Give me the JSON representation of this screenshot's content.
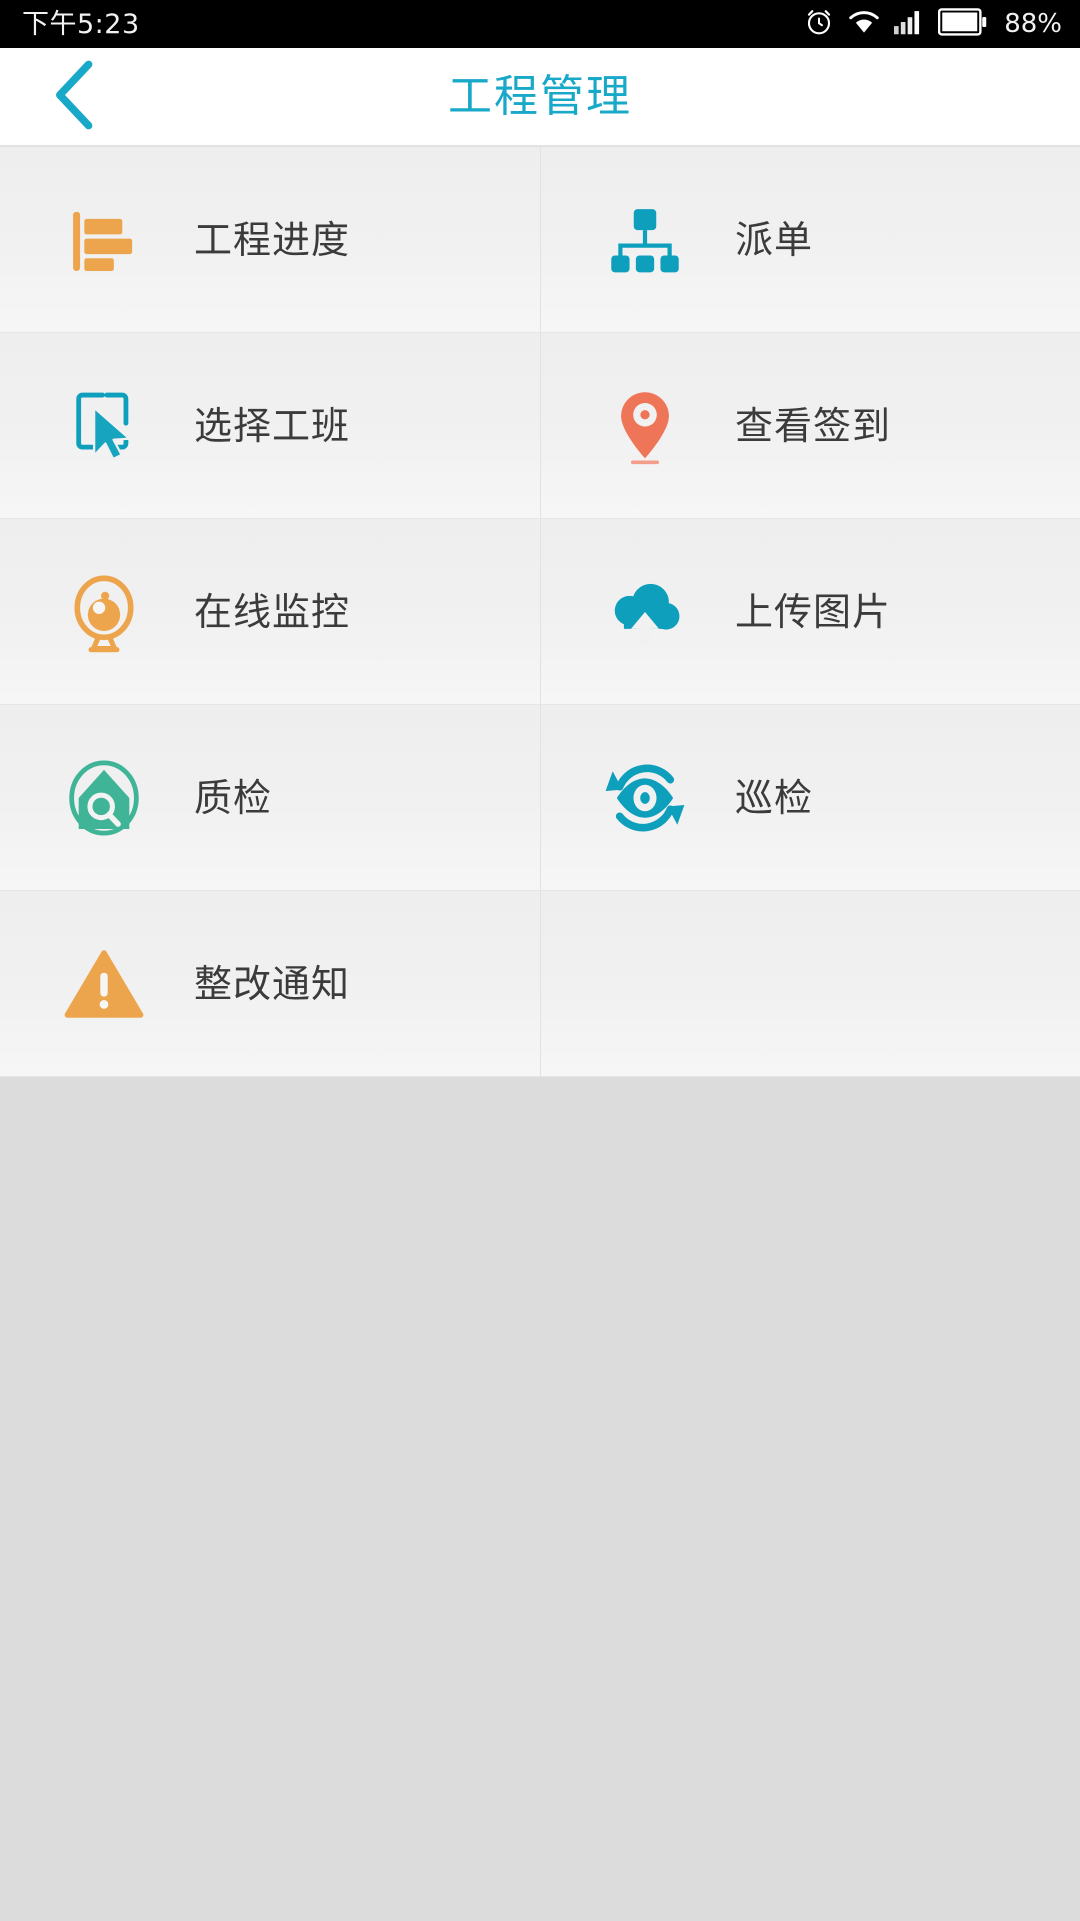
{
  "statusbar": {
    "time": "下午5:23",
    "battery_percent": "88%",
    "icons": [
      "alarm-icon",
      "wifi-icon",
      "signal-icon",
      "battery-icon"
    ]
  },
  "header": {
    "title": "工程管理",
    "back_icon": "chevron-left-icon",
    "accent_color": "#18a9c9"
  },
  "colors": {
    "teal": "#0d9fbc",
    "orange": "#eda54d",
    "coral": "#ee7557",
    "green": "#3fb496",
    "text": "#3b3b3b",
    "cell_bg": "#efefef",
    "page_bg": "#dcdcdc"
  },
  "grid": {
    "columns": 2,
    "items": [
      {
        "label": "工程进度",
        "icon": "bar-chart-icon",
        "color": "#eda54d"
      },
      {
        "label": "派单",
        "icon": "org-chart-icon",
        "color": "#0d9fbc"
      },
      {
        "label": "选择工班",
        "icon": "cursor-select-icon",
        "color": "#0d9fbc"
      },
      {
        "label": "查看签到",
        "icon": "map-pin-icon",
        "color": "#ee7557"
      },
      {
        "label": "在线监控",
        "icon": "camera-icon",
        "color": "#eda54d"
      },
      {
        "label": "上传图片",
        "icon": "cloud-upload-icon",
        "color": "#0d9fbc"
      },
      {
        "label": "质检",
        "icon": "house-inspect-icon",
        "color": "#3fb496"
      },
      {
        "label": "巡检",
        "icon": "eye-refresh-icon",
        "color": "#0d9fbc"
      },
      {
        "label": "整改通知",
        "icon": "warning-triangle-icon",
        "color": "#eda54d"
      },
      {
        "label": "",
        "icon": "",
        "color": ""
      }
    ]
  }
}
